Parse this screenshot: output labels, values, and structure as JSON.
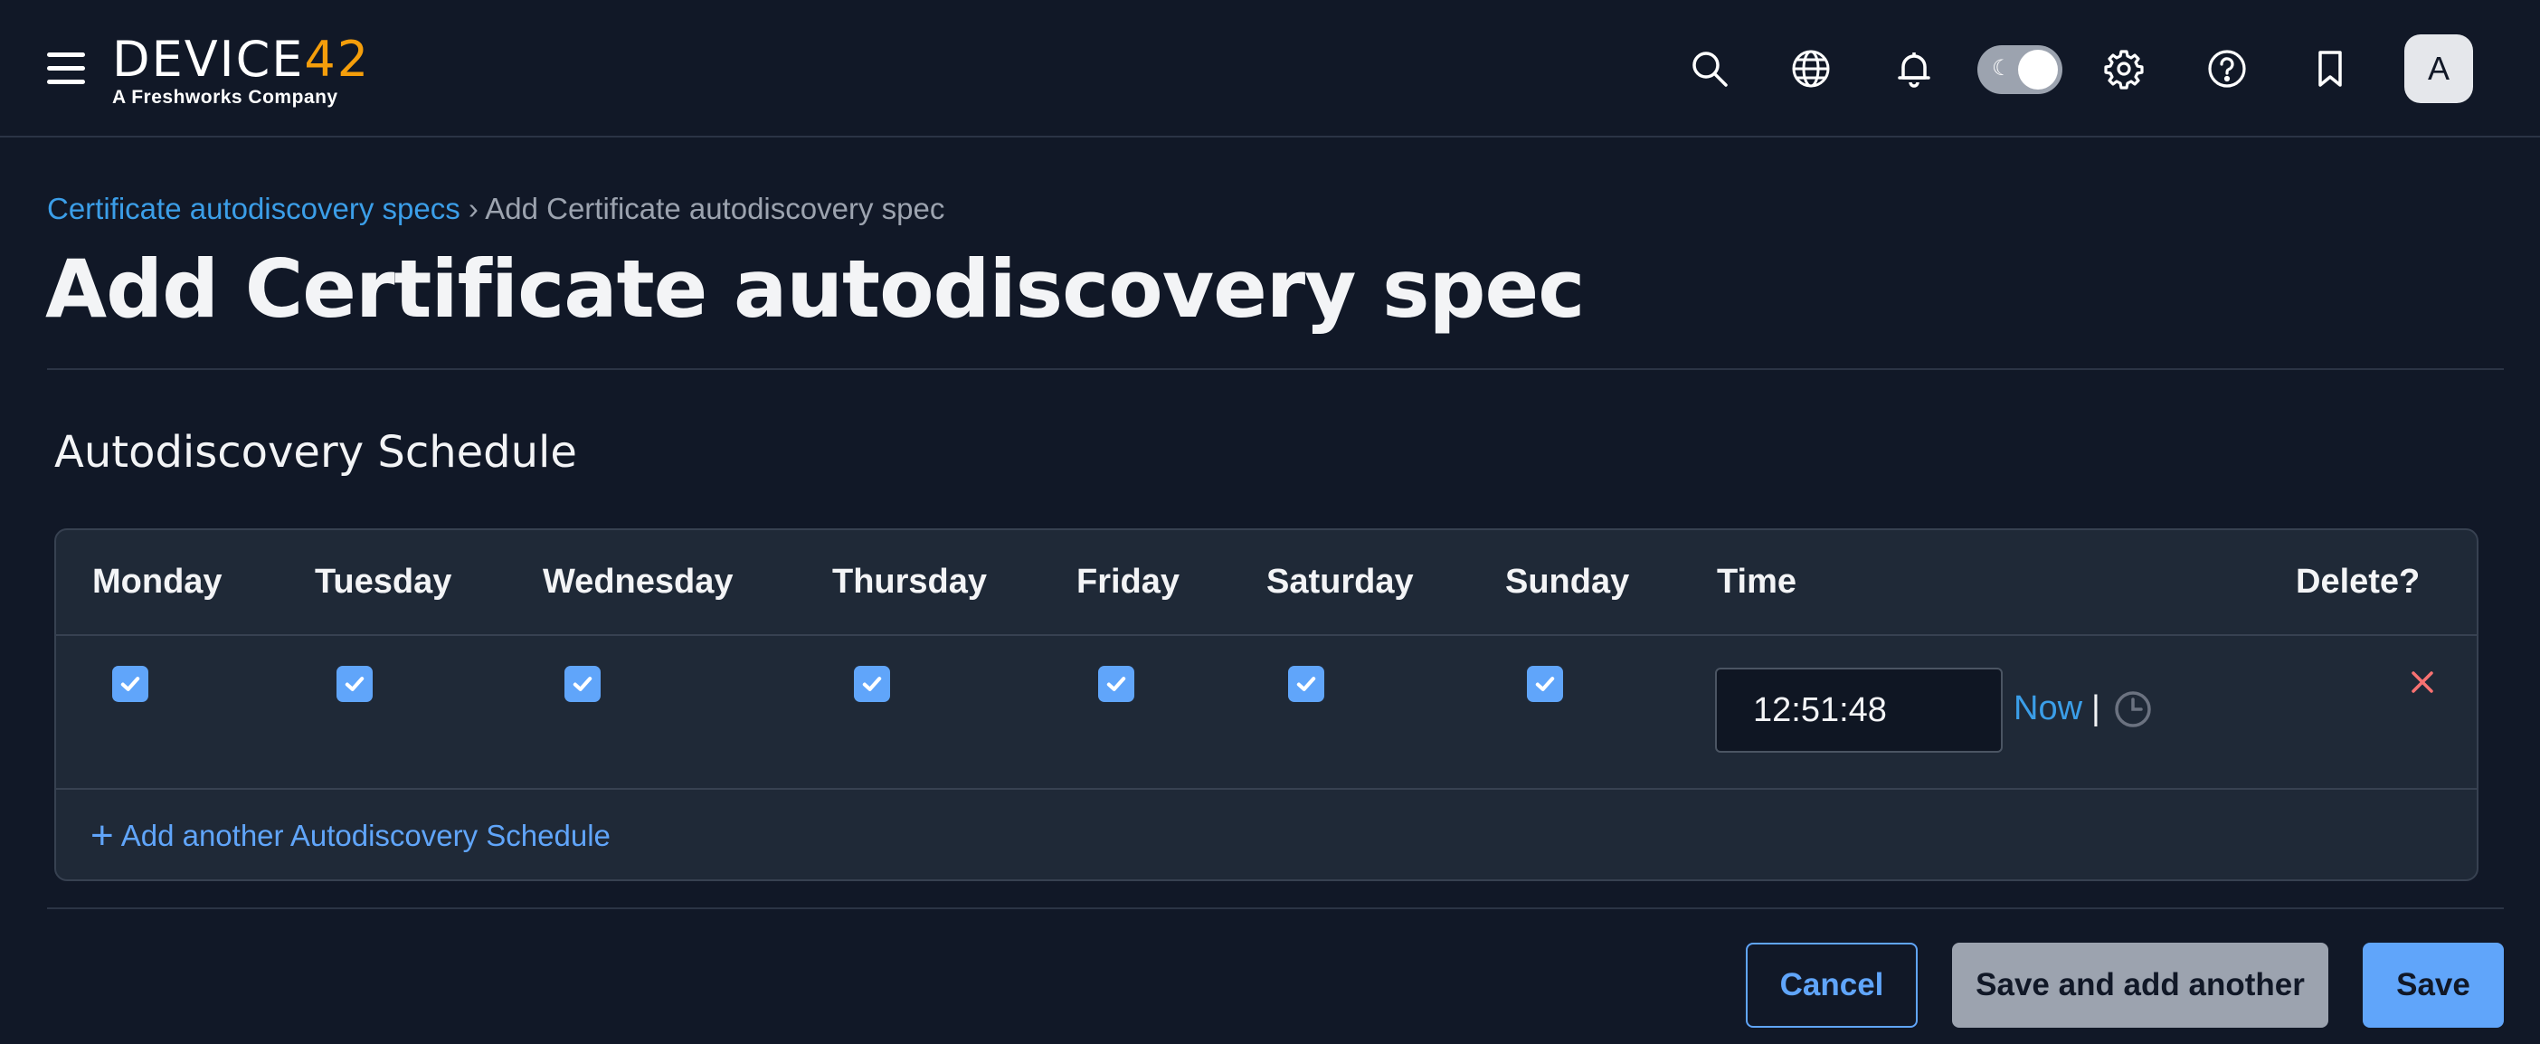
{
  "nav": {
    "logo_text": "DEVICE",
    "logo_accent": "42",
    "logo_sub": "A Freshworks Company",
    "icons": [
      "menu-icon",
      "search-icon",
      "globe-icon",
      "bell-icon",
      "theme-toggle",
      "gear-icon",
      "help-icon",
      "bookmark-icon"
    ],
    "avatar_initial": "A"
  },
  "breadcrumb": {
    "parent": "Certificate autodiscovery specs",
    "separator": "›",
    "current": "Add Certificate autodiscovery spec"
  },
  "page_title": "Add Certificate autodiscovery spec",
  "section": {
    "title": "Autodiscovery Schedule",
    "columns": [
      "Monday",
      "Tuesday",
      "Wednesday",
      "Thursday",
      "Friday",
      "Saturday",
      "Sunday",
      "Time",
      "Delete?"
    ],
    "row": {
      "days_checked": [
        true,
        true,
        true,
        true,
        true,
        true,
        true
      ],
      "time_value": "12:51:48",
      "now_label": "Now",
      "separator": "|"
    },
    "add_label": "Add another Autodiscovery Schedule"
  },
  "buttons": {
    "cancel": "Cancel",
    "save_and_add": "Save and add another",
    "save": "Save"
  },
  "colors": {
    "background": "#111827",
    "card": "#1f2937",
    "link": "#3b9ee8",
    "accent": "#60a5fa",
    "logo_accent": "#f59e0b",
    "delete": "#f87171"
  }
}
